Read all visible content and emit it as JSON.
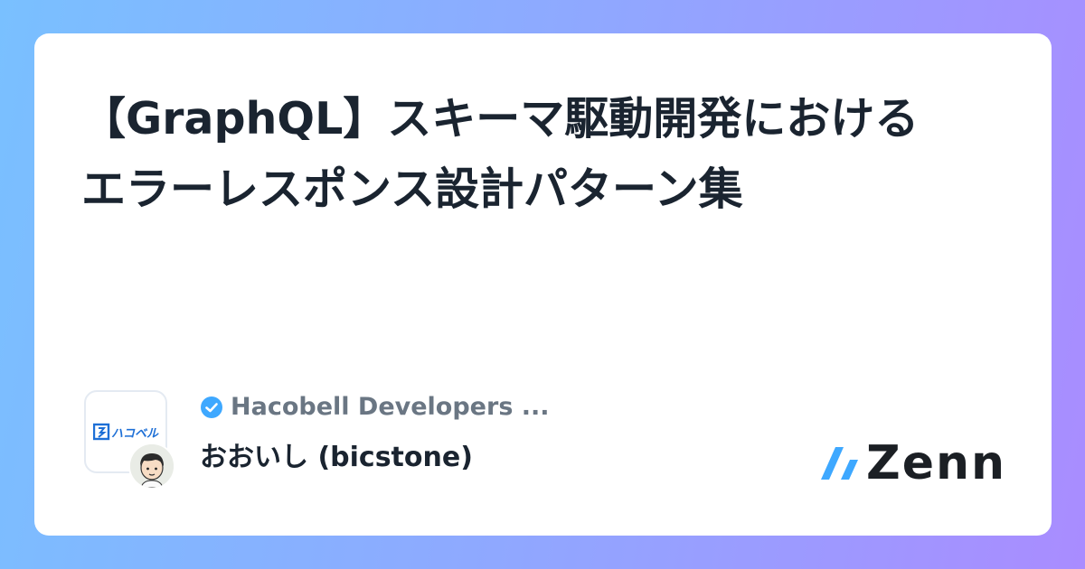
{
  "title": {
    "line1": "【GraphQL】スキーマ駆動開発における",
    "line2": "エラーレスポンス設計パターン集"
  },
  "publication": {
    "name": "Hacobell Developers ...",
    "logo_text": "ハコベル",
    "verified_icon": "verified-check-icon"
  },
  "author": {
    "name": "おおいし (bicstone)"
  },
  "brand": {
    "name": "Zenn",
    "accent": "#3ea8ff"
  }
}
